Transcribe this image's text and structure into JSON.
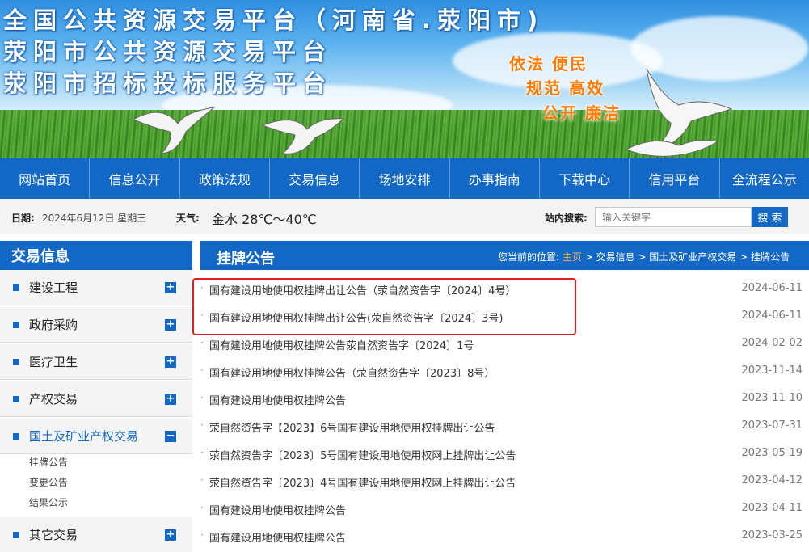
{
  "banner": {
    "title_lines": [
      "全国公共资源交易平台（河南省.荥阳市)",
      "荥阳市公共资源交易平台",
      "荥阳市招标投标服务平台"
    ],
    "slogans": [
      "依法  便民",
      "规范  高效",
      "公开  廉洁"
    ]
  },
  "nav": {
    "items": [
      "网站首页",
      "信息公开",
      "政策法规",
      "交易信息",
      "场地安排",
      "办事指南",
      "下载中心",
      "信用平台",
      "全流程公示"
    ]
  },
  "infobar": {
    "date_label": "日期:",
    "date_value": "2024年6月12日  星期三",
    "weather_label": "天气:",
    "weather_value": "金水 28℃～40℃",
    "search_label": "站内搜索:",
    "search_placeholder": "输入关键字",
    "search_button": "搜 索"
  },
  "sidebar": {
    "title": "交易信息",
    "items": [
      {
        "label": "建设工程",
        "toggle": "+"
      },
      {
        "label": "政府采购",
        "toggle": "+"
      },
      {
        "label": "医疗卫生",
        "toggle": "+"
      },
      {
        "label": "产权交易",
        "toggle": "+"
      },
      {
        "label": "国土及矿业产权交易",
        "toggle": "−"
      },
      {
        "label": "其它交易",
        "toggle": "+"
      }
    ],
    "subitems": [
      "挂牌公告",
      "变更公告",
      "结果公示"
    ]
  },
  "main": {
    "title": "挂牌公告",
    "breadcrumb": {
      "prefix": "您当前的位置:",
      "home": "主页",
      "rest": " > 交易信息 > 国土及矿业产权交易 > 挂牌公告"
    },
    "rows": [
      {
        "title": "国有建设用地使用权挂牌出让公告（荥自然资告字〔2024〕4号）",
        "date": "2024-06-11"
      },
      {
        "title": "国有建设用地使用权挂牌出让公告(荥自然资告字〔2024〕3号)",
        "date": "2024-06-11"
      },
      {
        "title": "国有建设用地使用权挂牌公告荥自然资告字〔2024〕1号",
        "date": "2024-02-02"
      },
      {
        "title": "国有建设用地使用权挂牌公告（荥自然资告字〔2023〕8号）",
        "date": "2023-11-14"
      },
      {
        "title": "国有建设用地使用权挂牌公告",
        "date": "2023-11-10"
      },
      {
        "title": "荥自然资告字【2023】6号国有建设用地使用权挂牌出让公告",
        "date": "2023-07-31"
      },
      {
        "title": "荥自然资告字〔2023〕5号国有建设用地使用权网上挂牌出让公告",
        "date": "2023-05-19"
      },
      {
        "title": "荥自然资告字〔2023〕4号国有建设用地使用权网上挂牌出让公告",
        "date": "2023-04-12"
      },
      {
        "title": "国有建设用地使用权挂牌公告",
        "date": "2023-04-11"
      },
      {
        "title": "国有建设用地使用权挂牌公告",
        "date": "2023-03-25"
      }
    ]
  },
  "colors": {
    "primary": "#1268c4",
    "slogan": "#ff7a00",
    "highlight": "#e02020"
  }
}
